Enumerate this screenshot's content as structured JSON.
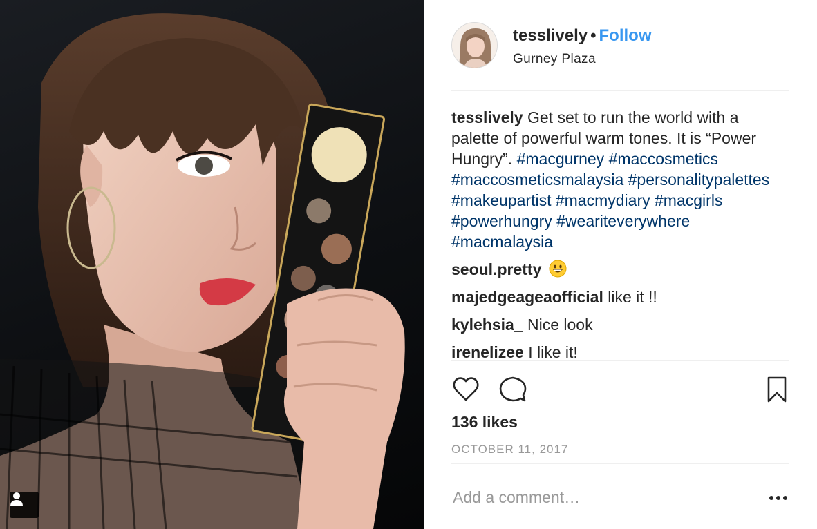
{
  "post": {
    "username": "tesslively",
    "dot": "•",
    "follow_label": "Follow",
    "location": "Gurney Plaza",
    "caption": {
      "username": "tesslively",
      "text": "Get set to run the world with a palette of powerful warm tones. It is “Power Hungry”.",
      "hashtags": [
        "#macgurney",
        "#maccosmetics",
        "#maccosmeticsmalaysia",
        "#personalitypalettes",
        "#makeupartist",
        "#macmydiary",
        "#macgirls",
        "#powerhungry",
        "#weariteverywhere",
        "#macmalaysia"
      ]
    },
    "comments": [
      {
        "username": "seoul.pretty",
        "text": "",
        "emoji": "grinning-face"
      },
      {
        "username": "majedgeageaofficial",
        "text": "like it !!"
      },
      {
        "username": "kylehsia_",
        "text": "Nice look"
      },
      {
        "username": "irenelizee",
        "text": "I like it!"
      }
    ],
    "likes": "136 likes",
    "date": "OCTOBER 11, 2017",
    "add_comment_placeholder": "Add a comment…"
  },
  "icons": {
    "like": "heart-icon",
    "comment": "speech-bubble-icon",
    "save": "bookmark-icon",
    "more": "ellipsis-icon",
    "tagged_user": "person-icon"
  },
  "colors": {
    "link": "#3897f0",
    "hashtag": "#003569",
    "muted": "#999999",
    "text": "#262626"
  }
}
